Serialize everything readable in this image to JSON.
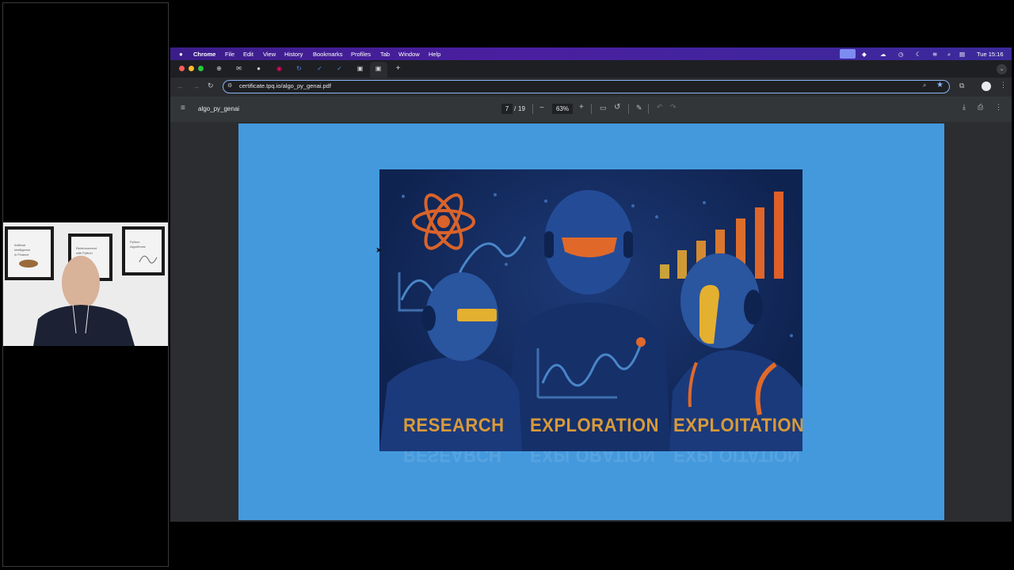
{
  "menubar": {
    "app": "Chrome",
    "items": [
      "File",
      "Edit",
      "View",
      "History",
      "Bookmarks",
      "Profiles",
      "Tab",
      "Window",
      "Help"
    ],
    "clock": "Tue 15:16"
  },
  "browser": {
    "url": "certificate.tpq.io/algo_py_genai.pdf",
    "new_tab": "+"
  },
  "pdf": {
    "title": "algo_py_genai",
    "page_current": "7",
    "page_sep": "/",
    "page_total": "19",
    "zoom": "63%",
    "zoom_out": "−",
    "zoom_in": "+"
  },
  "poster": {
    "labels": [
      "RESEARCH",
      "EXPLORATION",
      "EXPLOITATION"
    ]
  },
  "webcam": {
    "frame1": "Artificial Intelligence in Finance",
    "frame2": "Reinforcement Learning with Python",
    "frame3": "Python for Algorithmic Trading"
  },
  "colors": {
    "menubar": "#4a1fa0",
    "page_bg": "#4499dd",
    "poster_bg": "#0f2350",
    "label": "#d89a3a",
    "accent_orange": "#e0692a",
    "accent_blue": "#8ab4f8"
  }
}
